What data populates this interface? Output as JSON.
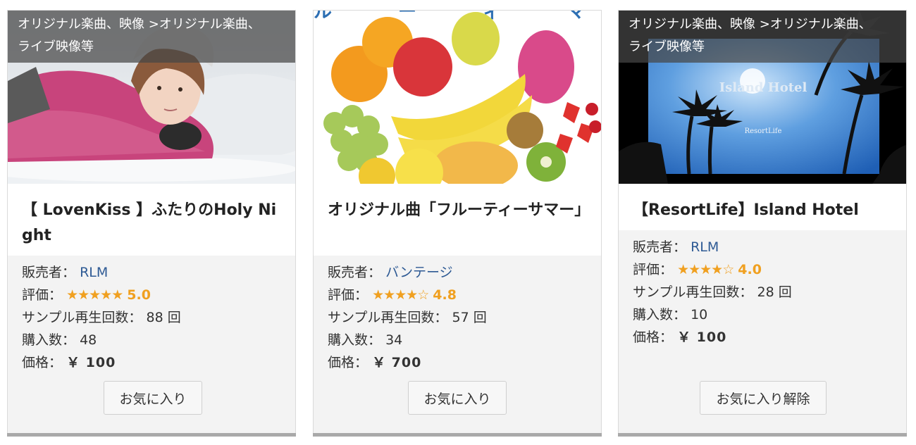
{
  "cards": [
    {
      "category": "オリジナル楽曲、映像 >オリジナル楽曲、\nライブ映像等",
      "title": "【 LovenKiss 】ふたりのHoly Night",
      "seller_label": "販売者：",
      "seller": "RLM",
      "rating_label": "評価：",
      "stars": "★★★★★",
      "rating": "5.0",
      "plays_label": "サンプル再生回数：",
      "plays": "88 回",
      "purchases_label": "購入数：",
      "purchases": "48",
      "price_label": "価格：",
      "price": "￥ 100",
      "button": "お気に入り"
    },
    {
      "category": "",
      "title": "オリジナル曲「フルーティーサマー」",
      "seller_label": "販売者：",
      "seller": "バンテージ",
      "rating_label": "評価：",
      "stars": "★★★★☆",
      "rating": "4.8",
      "plays_label": "サンプル再生回数：",
      "plays": "57 回",
      "purchases_label": "購入数：",
      "purchases": "34",
      "price_label": "価格：",
      "price": "￥ 700",
      "button": "お気に入り"
    },
    {
      "category": "オリジナル楽曲、映像 >オリジナル楽曲、\nライブ映像等",
      "title": "【ResortLife】Island Hotel",
      "thumb_text": "Island Hotel",
      "thumb_sub": "ResortLife",
      "seller_label": "販売者：",
      "seller": "RLM",
      "rating_label": "評価：",
      "stars": "★★★★☆",
      "rating": "4.0",
      "plays_label": "サンプル再生回数：",
      "plays": "28 回",
      "purchases_label": "購入数：",
      "purchases": "10",
      "price_label": "価格：",
      "price": "￥ 100",
      "button": "お気に入り解除"
    }
  ]
}
